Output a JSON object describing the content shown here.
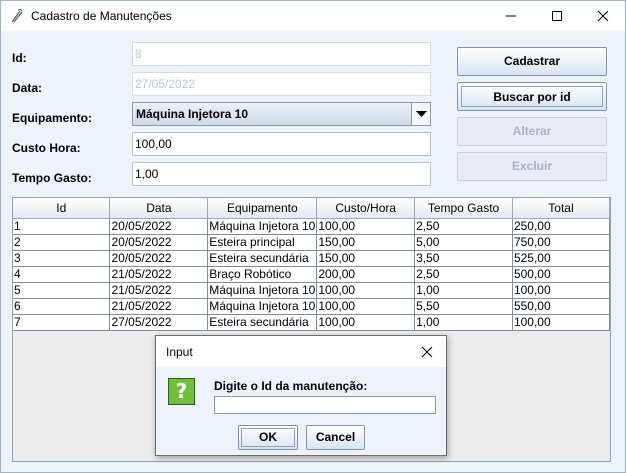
{
  "window": {
    "title": "Cadastro de Manutenções"
  },
  "form": {
    "id_label": "Id:",
    "id_value": "8",
    "data_label": "Data:",
    "data_value": "27/05/2022",
    "equipamento_label": "Equipamento:",
    "equipamento_value": "Máquina Injetora 10",
    "custo_hora_label": "Custo Hora:",
    "custo_hora_value": "100,00",
    "tempo_gasto_label": "Tempo Gasto:",
    "tempo_gasto_value": "1,00"
  },
  "buttons": {
    "cadastrar": "Cadastrar",
    "buscar": "Buscar por id",
    "alterar": "Alterar",
    "excluir": "Excluir"
  },
  "table": {
    "headers": [
      "Id",
      "Data",
      "Equipamento",
      "Custo/Hora",
      "Tempo Gasto",
      "Total"
    ],
    "rows": [
      [
        "1",
        "20/05/2022",
        "Máquina Injetora 10",
        "100,00",
        "2,50",
        "250,00"
      ],
      [
        "2",
        "20/05/2022",
        "Esteira principal",
        "150,00",
        "5,00",
        "750,00"
      ],
      [
        "3",
        "20/05/2022",
        "Esteira secundária",
        "150,00",
        "3,50",
        "525,00"
      ],
      [
        "4",
        "21/05/2022",
        "Braço Robótico",
        "200,00",
        "2,50",
        "500,00"
      ],
      [
        "5",
        "21/05/2022",
        "Máquina Injetora 10",
        "100,00",
        "1,00",
        "100,00"
      ],
      [
        "6",
        "21/05/2022",
        "Máquina Injetora 10",
        "100,00",
        "5,50",
        "550,00"
      ],
      [
        "7",
        "27/05/2022",
        "Esteira secundária",
        "100,00",
        "1,00",
        "100,00"
      ]
    ]
  },
  "dialog": {
    "title": "Input",
    "message": "Digite o Id da manutenção:",
    "input_value": "",
    "ok_label": "OK",
    "cancel_label": "Cancel",
    "icon": "question-icon",
    "icon_glyph": "?"
  },
  "colors": {
    "window_bg": "#eef3fa",
    "disabled_text": "#b8c4d4",
    "question_icon": "#6fbf3a"
  }
}
